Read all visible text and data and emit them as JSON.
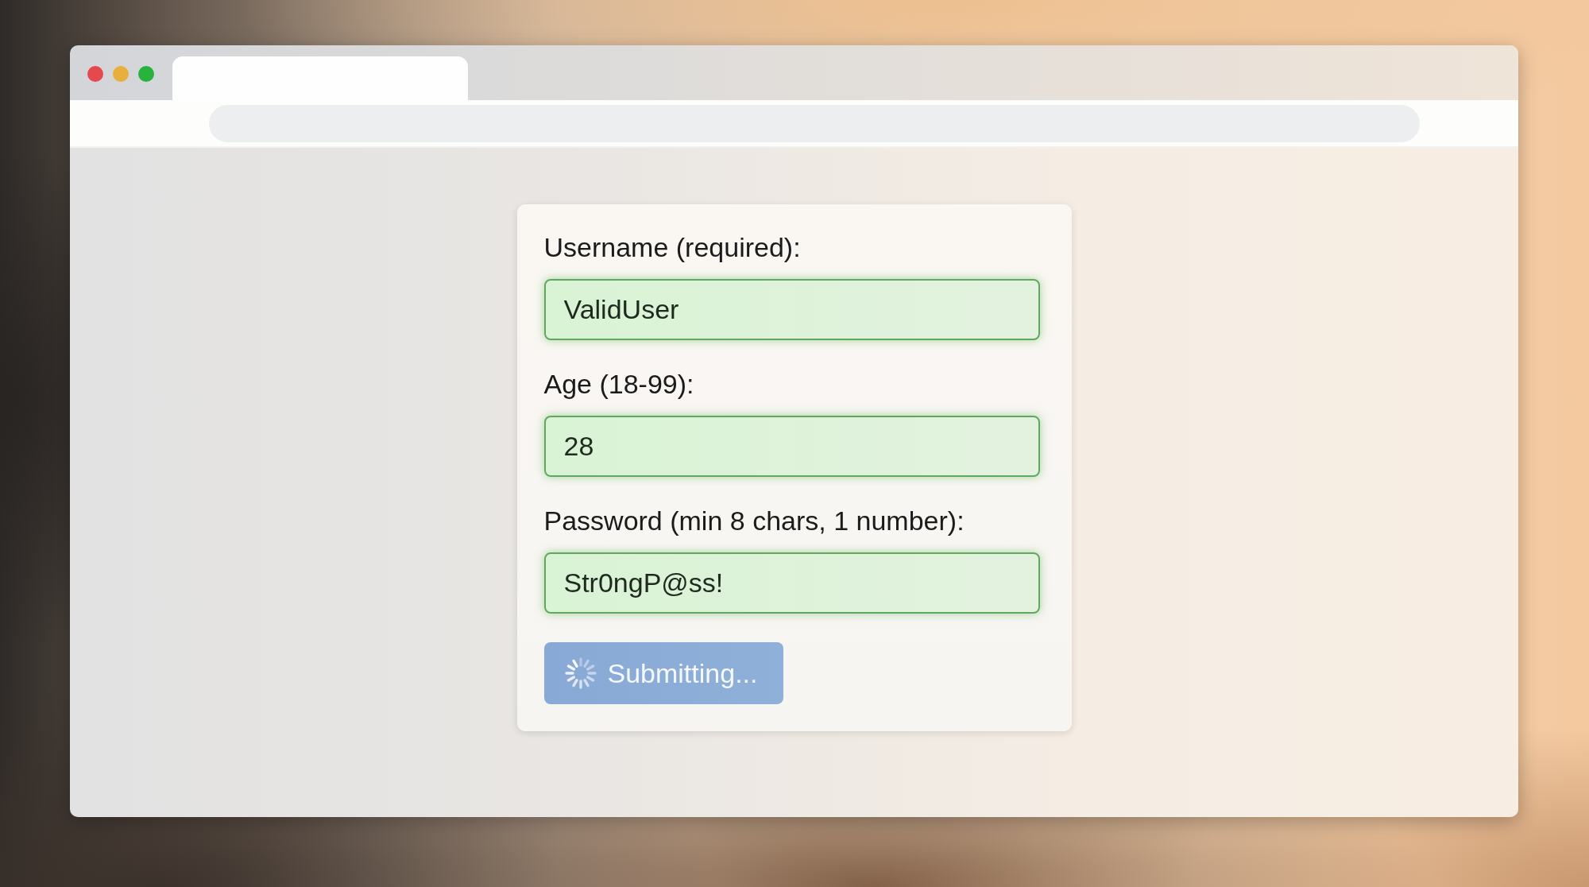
{
  "browser": {
    "tabs": [
      {
        "selected": true
      }
    ]
  },
  "form": {
    "fields": [
      {
        "label": "Username (required):",
        "value": "ValidUser",
        "valid": true
      },
      {
        "label": "Age (18-99):",
        "value": "28",
        "valid": true
      },
      {
        "label": "Password (min 8 chars, 1 number):",
        "value": "Str0ngP@ss!",
        "valid": true
      }
    ],
    "submit_button": {
      "label": "Submitting...",
      "loading": true
    }
  }
}
